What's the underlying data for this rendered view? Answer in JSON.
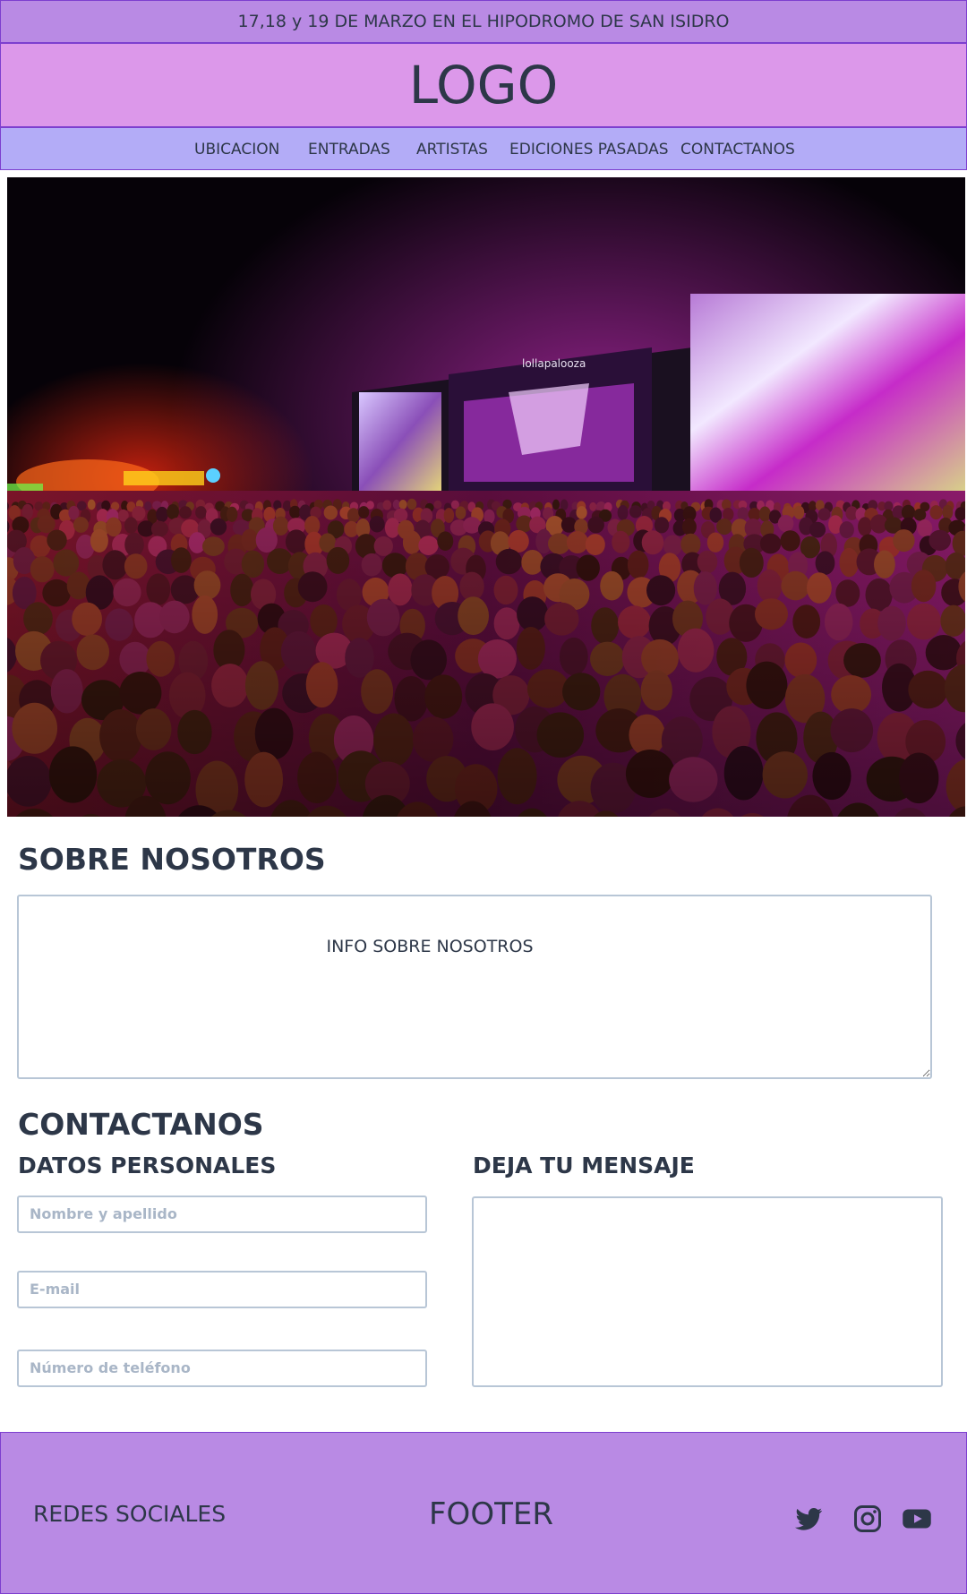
{
  "announcement": "17,18 y 19 DE MARZO EN EL HIPODROMO DE SAN ISIDRO",
  "logo": "LOGO",
  "nav": {
    "items": [
      {
        "label": "UBICACION"
      },
      {
        "label": "ENTRADAS"
      },
      {
        "label": "ARTISTAS"
      },
      {
        "label": "EDICIONES PASADAS"
      },
      {
        "label": "CONTACTANOS"
      }
    ]
  },
  "hero": {
    "stage_sign": "lollapalooza"
  },
  "about": {
    "title": "SOBRE NOSOTROS",
    "content": "INFO SOBRE NOSOTROS"
  },
  "contact": {
    "title": "CONTACTANOS",
    "personal_title": "DATOS PERSONALES",
    "message_title": "DEJA TU MENSAJE",
    "name_placeholder": "Nombre y apellido",
    "email_placeholder": "E-mail",
    "phone_placeholder": "Número de teléfono",
    "message_placeholder": ""
  },
  "footer": {
    "social_label": "REDES SOCIALES",
    "title": "FOOTER",
    "icons": [
      "twitter-icon",
      "instagram-icon",
      "youtube-icon"
    ]
  },
  "colors": {
    "topbar": "#b98ae4",
    "logo_bar": "#dc98ea",
    "nav_bar": "#b3acf7",
    "border": "#7d3fcf",
    "text": "#2d3748"
  }
}
